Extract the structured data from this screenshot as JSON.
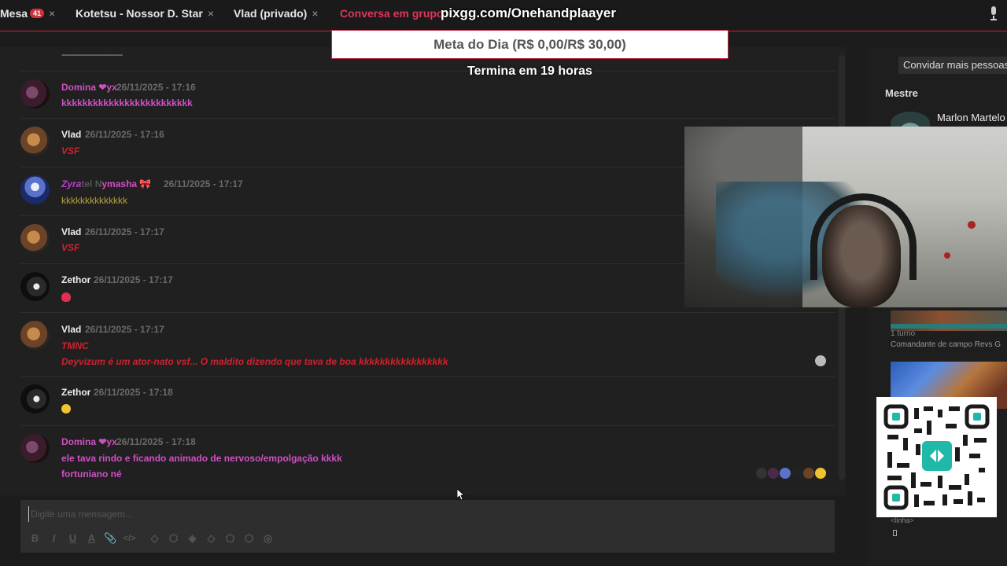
{
  "tabs": [
    {
      "label": "Mesa",
      "badge": "41",
      "close": "×"
    },
    {
      "label": "Kotetsu - Nossor D. Star",
      "close": "×"
    },
    {
      "label": "Vlad (privado)",
      "close": "×"
    },
    {
      "label": "Conversa em grupo",
      "close": "×"
    }
  ],
  "overlay": {
    "url": "pixgg.com/Onehandplaayer",
    "goal": "Meta do Dia (R$ 0,00/R$ 30,00)",
    "ends": "Termina em 19 horas"
  },
  "chat": {
    "dashes": "-----------------------------",
    "messages": [
      {
        "user": "Domina ❤yx",
        "time": "26/11/2025 - 17:16",
        "lines": [
          "kkkkkkkkkkkkkkkkkkkkkkkkk"
        ]
      },
      {
        "user": "Vlad",
        "time": "26/11/2025 - 17:16",
        "lines": [
          "VSF"
        ]
      },
      {
        "user_parts": [
          "Zyra",
          "tel N",
          "ymasha 🎀"
        ],
        "time": "26/11/2025 - 17:17",
        "lines": [
          "kkkkkkkkkkkkkk"
        ]
      },
      {
        "user": "Vlad",
        "time": "26/11/2025 - 17:17",
        "lines": [
          "VSF"
        ]
      },
      {
        "user": "Zethor",
        "time": "26/11/2025 - 17:17",
        "lines": []
      },
      {
        "user": "Vlad",
        "time": "26/11/2025 - 17:17",
        "lines": [
          "TMNC",
          "Deyvizum é um ator-nato vsf... O maldito dizendo que tava de boa kkkkkkkkkkkkkkkkk"
        ]
      },
      {
        "user": "Zethor",
        "time": "26/11/2025 - 17:18",
        "lines": []
      },
      {
        "user": "Domina ❤yx",
        "time": "26/11/2025 - 17:18",
        "lines": [
          "ele tava rindo e ficando animado de nervoso/empolgação kkkk",
          "fortuniano né"
        ]
      }
    ]
  },
  "composer": {
    "placeholder": "Digite uma mensagem...",
    "tools": [
      "B",
      "I",
      "U",
      "A",
      "📎",
      "</>",
      "◇",
      "⬡",
      "◈",
      "◇",
      "⬠",
      "⬡",
      "◎"
    ]
  },
  "right_panel": {
    "invite": "Convidar mais pessoas",
    "section": "Mestre",
    "master_name": "Marlon Martelo",
    "turns": "1 turno",
    "commander": "Comandante de campo Revs G",
    "linha": "<linha>"
  },
  "colors": {
    "accent": "#e0355a",
    "pink_text": "#d14fc6",
    "red_text": "#d0202e",
    "olive_text": "#b7a23a"
  }
}
